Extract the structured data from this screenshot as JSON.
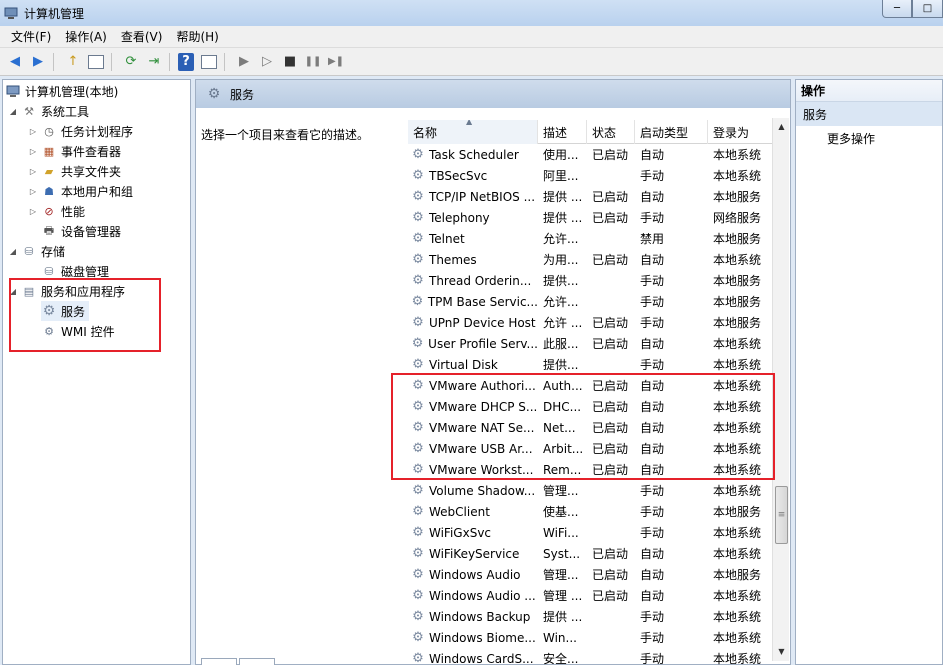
{
  "window": {
    "title": "计算机管理",
    "min_glyph": "─",
    "max_glyph": "□"
  },
  "menu": [
    "文件(F)",
    "操作(A)",
    "查看(V)",
    "帮助(H)"
  ],
  "toolbar": {
    "back": "◀",
    "forward": "▶",
    "up": "↑",
    "refresh": "⟳",
    "export": "⇥",
    "help": "?",
    "play": "▶",
    "play2": "▷",
    "stop": "■",
    "pause": "❚❚",
    "restart": "▶❚"
  },
  "tree": {
    "root": "计算机管理(本地)",
    "system_tools": "系统工具",
    "task_scheduler": "任务计划程序",
    "event_viewer": "事件查看器",
    "shared_folders": "共享文件夹",
    "local_users": "本地用户和组",
    "performance": "性能",
    "device_manager": "设备管理器",
    "storage": "存储",
    "disk_mgmt": "磁盘管理",
    "services_apps": "服务和应用程序",
    "services": "服务",
    "wmi": "WMI 控件"
  },
  "center": {
    "header": "服务",
    "description_hint": "选择一个项目来查看它的描述。",
    "columns": {
      "name": "名称",
      "desc": "描述",
      "status": "状态",
      "startup": "启动类型",
      "logon": "登录为"
    }
  },
  "services": [
    {
      "name": "Task Scheduler",
      "desc": "使用...",
      "status": "已启动",
      "startup": "自动",
      "logon": "本地系统"
    },
    {
      "name": "TBSecSvc",
      "desc": "阿里...",
      "status": "",
      "startup": "手动",
      "logon": "本地系统"
    },
    {
      "name": "TCP/IP NetBIOS ...",
      "desc": "提供 ...",
      "status": "已启动",
      "startup": "自动",
      "logon": "本地服务"
    },
    {
      "name": "Telephony",
      "desc": "提供 ...",
      "status": "已启动",
      "startup": "手动",
      "logon": "网络服务"
    },
    {
      "name": "Telnet",
      "desc": "允许...",
      "status": "",
      "startup": "禁用",
      "logon": "本地服务"
    },
    {
      "name": "Themes",
      "desc": "为用...",
      "status": "已启动",
      "startup": "自动",
      "logon": "本地系统"
    },
    {
      "name": "Thread Orderin...",
      "desc": "提供...",
      "status": "",
      "startup": "手动",
      "logon": "本地服务"
    },
    {
      "name": "TPM Base Servic...",
      "desc": "允许...",
      "status": "",
      "startup": "手动",
      "logon": "本地服务"
    },
    {
      "name": "UPnP Device Host",
      "desc": "允许 ...",
      "status": "已启动",
      "startup": "手动",
      "logon": "本地服务"
    },
    {
      "name": "User Profile Serv...",
      "desc": "此服...",
      "status": "已启动",
      "startup": "自动",
      "logon": "本地系统"
    },
    {
      "name": "Virtual Disk",
      "desc": "提供...",
      "status": "",
      "startup": "手动",
      "logon": "本地系统"
    },
    {
      "name": "VMware Authori...",
      "desc": "Auth...",
      "status": "已启动",
      "startup": "自动",
      "logon": "本地系统"
    },
    {
      "name": "VMware DHCP S...",
      "desc": "DHC...",
      "status": "已启动",
      "startup": "自动",
      "logon": "本地系统"
    },
    {
      "name": "VMware NAT Se...",
      "desc": "Net...",
      "status": "已启动",
      "startup": "自动",
      "logon": "本地系统"
    },
    {
      "name": "VMware USB Ar...",
      "desc": "Arbit...",
      "status": "已启动",
      "startup": "自动",
      "logon": "本地系统"
    },
    {
      "name": "VMware Workst...",
      "desc": "Rem...",
      "status": "已启动",
      "startup": "自动",
      "logon": "本地系统"
    },
    {
      "name": "Volume Shadow...",
      "desc": "管理...",
      "status": "",
      "startup": "手动",
      "logon": "本地系统"
    },
    {
      "name": "WebClient",
      "desc": "使基...",
      "status": "",
      "startup": "手动",
      "logon": "本地服务"
    },
    {
      "name": "WiFiGxSvc",
      "desc": "WiFi...",
      "status": "",
      "startup": "手动",
      "logon": "本地系统"
    },
    {
      "name": "WiFiKeyService",
      "desc": "Syst...",
      "status": "已启动",
      "startup": "自动",
      "logon": "本地系统"
    },
    {
      "name": "Windows Audio",
      "desc": "管理...",
      "status": "已启动",
      "startup": "自动",
      "logon": "本地服务"
    },
    {
      "name": "Windows Audio ...",
      "desc": "管理 ...",
      "status": "已启动",
      "startup": "自动",
      "logon": "本地系统"
    },
    {
      "name": "Windows Backup",
      "desc": "提供 ...",
      "status": "",
      "startup": "手动",
      "logon": "本地系统"
    },
    {
      "name": "Windows Biome...",
      "desc": "Win...",
      "status": "",
      "startup": "手动",
      "logon": "本地系统"
    },
    {
      "name": "Windows CardS...",
      "desc": "安全...",
      "status": "",
      "startup": "手动",
      "logon": "本地系统"
    }
  ],
  "actions": {
    "title": "操作",
    "section": "服务",
    "more": "更多操作"
  },
  "scroll": {
    "up": "▲",
    "down": "▼",
    "grip": "≡"
  },
  "colors": {
    "highlight": "#e5212a",
    "header_bg": "#cfdcec",
    "selection": "#e5eef9"
  }
}
